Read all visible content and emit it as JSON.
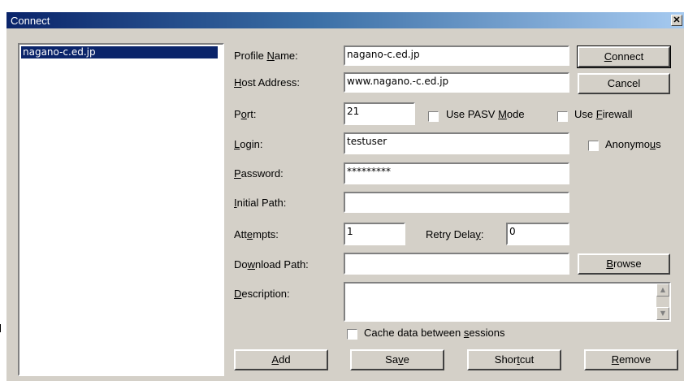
{
  "window": {
    "title": "Connect"
  },
  "profiles": [
    "nagano-c.ed.jp"
  ],
  "fields": {
    "profile_name": {
      "label_pre": "Profile ",
      "label_key": "N",
      "label_post": "ame:",
      "value": "nagano-c.ed.jp"
    },
    "host_address": {
      "label_pre": "",
      "label_key": "H",
      "label_post": "ost Address:",
      "value": "www.nagano.-c.ed.jp"
    },
    "port": {
      "label_pre": "P",
      "label_key": "o",
      "label_post": "rt:",
      "value": "21"
    },
    "login": {
      "label_pre": "",
      "label_key": "L",
      "label_post": "ogin:",
      "value": "testuser"
    },
    "password": {
      "label_pre": "",
      "label_key": "P",
      "label_post": "assword:",
      "value": "*********"
    },
    "initial_path": {
      "label_pre": "",
      "label_key": "I",
      "label_post": "nitial Path:",
      "value": ""
    },
    "attempts": {
      "label_pre": "Att",
      "label_key": "e",
      "label_post": "mpts:",
      "value": "1"
    },
    "retry_delay": {
      "label_pre": "Retry Dela",
      "label_key": "y",
      "label_post": ":",
      "value": "0"
    },
    "download_path": {
      "label_pre": "Do",
      "label_key": "w",
      "label_post": "nload Path:",
      "value": ""
    },
    "description": {
      "label_pre": "",
      "label_key": "D",
      "label_post": "escription:",
      "value": ""
    }
  },
  "checkboxes": {
    "pasv": {
      "pre": "Use PASV ",
      "key": "M",
      "post": "ode",
      "checked": false
    },
    "firewall": {
      "pre": "Use ",
      "key": "F",
      "post": "irewall",
      "checked": false
    },
    "anonymous": {
      "pre": "Anonymo",
      "key": "u",
      "post": "s",
      "checked": false
    },
    "cache": {
      "pre": "Cache data between ",
      "key": "s",
      "post": "essions",
      "checked": false
    }
  },
  "buttons": {
    "connect": {
      "pre": "",
      "key": "C",
      "post": "onnect"
    },
    "cancel": {
      "pre": "Cancel",
      "key": "",
      "post": ""
    },
    "browse": {
      "pre": "",
      "key": "B",
      "post": "rowse"
    },
    "add": {
      "pre": "",
      "key": "A",
      "post": "dd"
    },
    "save": {
      "pre": "Sa",
      "key": "v",
      "post": "e"
    },
    "shortcut": {
      "pre": "Shor",
      "key": "t",
      "post": "cut"
    },
    "remove": {
      "pre": "",
      "key": "R",
      "post": "emove"
    }
  },
  "icons": {
    "close": "close-icon",
    "scroll_up": "scroll-up-icon",
    "scroll_down": "scroll-down-icon"
  },
  "colors": {
    "title_start": "#0a246a",
    "title_end": "#a6caf0",
    "face": "#d4d0c8",
    "selection": "#0a246a"
  }
}
